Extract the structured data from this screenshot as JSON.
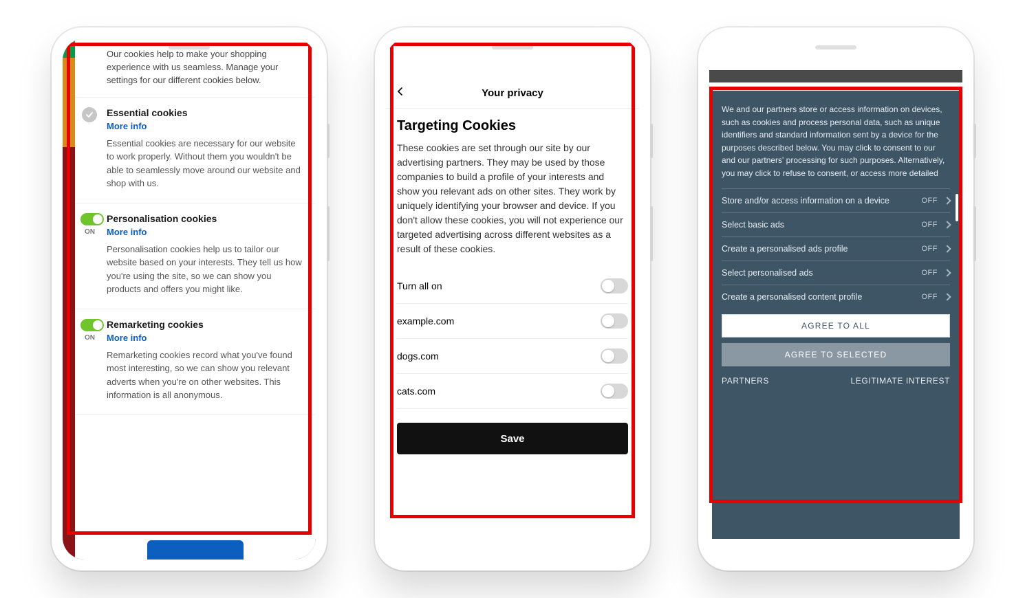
{
  "phone1": {
    "intro": "Our cookies help to make your shopping experience with us seamless. Manage your settings for our different cookies below.",
    "sections": [
      {
        "title": "Essential cookies",
        "more": "More info",
        "desc": "Essential cookies are necessary for our website to work properly. Without them you wouldn't be able to seamlessly move around our website and shop with us."
      },
      {
        "title": "Personalisation cookies",
        "more": "More info",
        "state": "ON",
        "desc": "Personalisation cookies help us to tailor our website based on your interests. They tell us how you're using the site, so we can show you products and offers you might like."
      },
      {
        "title": "Remarketing cookies",
        "more": "More info",
        "state": "ON",
        "desc": "Remarketing cookies record what you've found most interesting, so we can show you relevant adverts when you're on other websites. This information is all anonymous."
      }
    ]
  },
  "phone2": {
    "header": "Your privacy",
    "title": "Targeting Cookies",
    "desc": "These cookies are set through our site by our advertising partners. They may be used by those companies to build a profile of your interests and show you relevant ads on other sites. They work by uniquely identifying your browser and device. If you don't allow these cookies, you will not experience our targeted advertising across different websites as a result of these cookies.",
    "rows": [
      {
        "label": "Turn all on"
      },
      {
        "label": "example.com"
      },
      {
        "label": "dogs.com"
      },
      {
        "label": "cats.com"
      }
    ],
    "save": "Save"
  },
  "phone3": {
    "desc": "We and our partners store or access information on devices, such as cookies and process personal data, such as unique identifiers and standard information sent by a device for the purposes described below. You may click to consent to our and our partners' processing for such purposes. Alternatively, you may click to refuse to consent, or access more detailed",
    "rows": [
      {
        "label": "Store and/or access information on a device",
        "state": "OFF"
      },
      {
        "label": "Select basic ads",
        "state": "OFF"
      },
      {
        "label": "Create a personalised ads profile",
        "state": "OFF"
      },
      {
        "label": "Select personalised ads",
        "state": "OFF"
      },
      {
        "label": "Create a personalised content profile",
        "state": "OFF"
      }
    ],
    "agree_all": "AGREE TO ALL",
    "agree_selected": "AGREE TO SELECTED",
    "partners": "PARTNERS",
    "legit": "LEGITIMATE INTEREST"
  }
}
